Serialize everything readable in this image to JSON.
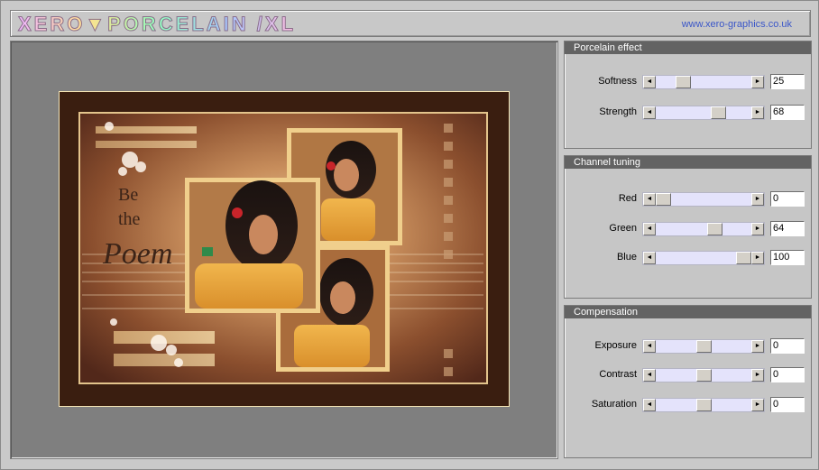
{
  "header": {
    "logo_text": "XERO▼PORCELAIN /XL",
    "url": "www.xero-graphics.co.uk"
  },
  "preview": {
    "poster_lines": [
      "Be",
      "the",
      "Poem"
    ]
  },
  "panels": [
    {
      "title": "Porcelain effect",
      "sliders": [
        {
          "label": "Softness",
          "value": "25",
          "fraction": 0.25
        },
        {
          "label": "Strength",
          "value": "68",
          "fraction": 0.68
        }
      ]
    },
    {
      "title": "Channel tuning",
      "sliders": [
        {
          "label": "Red",
          "value": "0",
          "fraction": 0.0
        },
        {
          "label": "Green",
          "value": "64",
          "fraction": 0.64
        },
        {
          "label": "Blue",
          "value": "100",
          "fraction": 1.0
        }
      ]
    },
    {
      "title": "Compensation",
      "sliders": [
        {
          "label": "Exposure",
          "value": "0",
          "fraction": 0.5
        },
        {
          "label": "Contrast",
          "value": "0",
          "fraction": 0.5
        },
        {
          "label": "Saturation",
          "value": "0",
          "fraction": 0.5
        }
      ]
    }
  ],
  "icons": {
    "left_arrow": "arrow-left-icon",
    "right_arrow": "arrow-right-icon"
  },
  "colors": {
    "panel_header": "#636363",
    "slider_track": "#e4e3fb",
    "url_blue": "#3a56c8"
  }
}
